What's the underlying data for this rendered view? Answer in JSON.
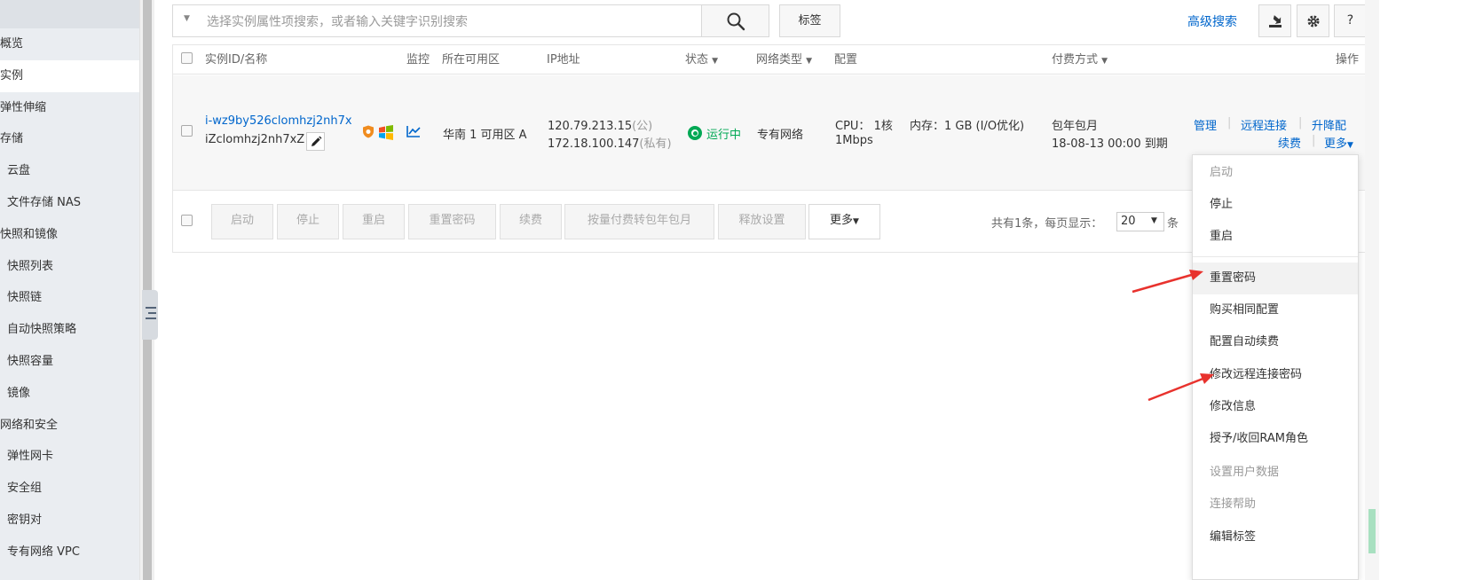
{
  "sidebar": {
    "items": [
      {
        "label": "概览",
        "type": "section"
      },
      {
        "label": "实例",
        "type": "section",
        "active": true
      },
      {
        "label": "弹性伸缩",
        "type": "section"
      },
      {
        "label": "存储",
        "type": "section"
      },
      {
        "label": "云盘",
        "type": "sub"
      },
      {
        "label": "文件存储 NAS",
        "type": "sub"
      },
      {
        "label": "快照和镜像",
        "type": "section"
      },
      {
        "label": "快照列表",
        "type": "sub"
      },
      {
        "label": "快照链",
        "type": "sub"
      },
      {
        "label": "自动快照策略",
        "type": "sub"
      },
      {
        "label": "快照容量",
        "type": "sub"
      },
      {
        "label": "镜像",
        "type": "sub"
      },
      {
        "label": "网络和安全",
        "type": "section"
      },
      {
        "label": "弹性网卡",
        "type": "sub"
      },
      {
        "label": "安全组",
        "type": "sub"
      },
      {
        "label": "密钥对",
        "type": "sub"
      },
      {
        "label": "专有网络 VPC",
        "type": "sub"
      }
    ]
  },
  "search": {
    "placeholder": "选择实例属性项搜索，或者输入关键字识别搜索",
    "tag_label": "标签",
    "advanced_label": "高级搜索",
    "help_label": "?"
  },
  "table": {
    "headers": {
      "id_name": "实例ID/名称",
      "monitor": "监控",
      "zone": "所在可用区",
      "ip": "IP地址",
      "status": "状态",
      "network": "网络类型",
      "config": "配置",
      "billing": "付费方式",
      "actions": "操作"
    },
    "row": {
      "instance_id": "i-wz9by526clomhzj2nh7x",
      "instance_name": "iZclomhzj2nh7xZ",
      "zone": "华南 1 可用区 A",
      "public_ip": "120.79.213.15",
      "public_tag": "(公)",
      "private_ip": "172.18.100.147",
      "private_tag": "(私有)",
      "status": "运行中",
      "network": "专有网络",
      "cpu": "CPU： 1核",
      "memory": "内存：1 GB (I/O优化)",
      "bandwidth": "1Mbps",
      "billing_type": "包年包月",
      "expiry": "18-08-13 00:00 到期",
      "actions": {
        "manage": "管理",
        "remote": "远程连接",
        "upgrade": "升降配",
        "renew": "续费",
        "more": "更多"
      }
    },
    "footer": {
      "buttons": [
        "启动",
        "停止",
        "重启",
        "重置密码",
        "续费",
        "按量付费转包年包月",
        "释放设置",
        "更多"
      ],
      "total": "共有1条，每页显示：",
      "page_size": "20",
      "unit": "条"
    }
  },
  "dropdown": {
    "items": [
      {
        "label": "启动",
        "disabled": true
      },
      {
        "label": "停止",
        "disabled": false
      },
      {
        "label": "重启",
        "disabled": false
      },
      {
        "label": "重置密码",
        "disabled": false,
        "hover": true
      },
      {
        "label": "购买相同配置",
        "disabled": false
      },
      {
        "label": "配置自动续费",
        "disabled": false
      },
      {
        "label": "修改远程连接密码",
        "disabled": false
      },
      {
        "label": "修改信息",
        "disabled": false
      },
      {
        "label": "授予/收回RAM角色",
        "disabled": false
      },
      {
        "label": "设置用户数据",
        "disabled": true
      },
      {
        "label": "连接帮助",
        "disabled": true
      },
      {
        "label": "编辑标签",
        "disabled": false
      }
    ]
  },
  "colors": {
    "accent": "#0066cc",
    "running": "#00a854",
    "arrow": "#e8322d"
  }
}
